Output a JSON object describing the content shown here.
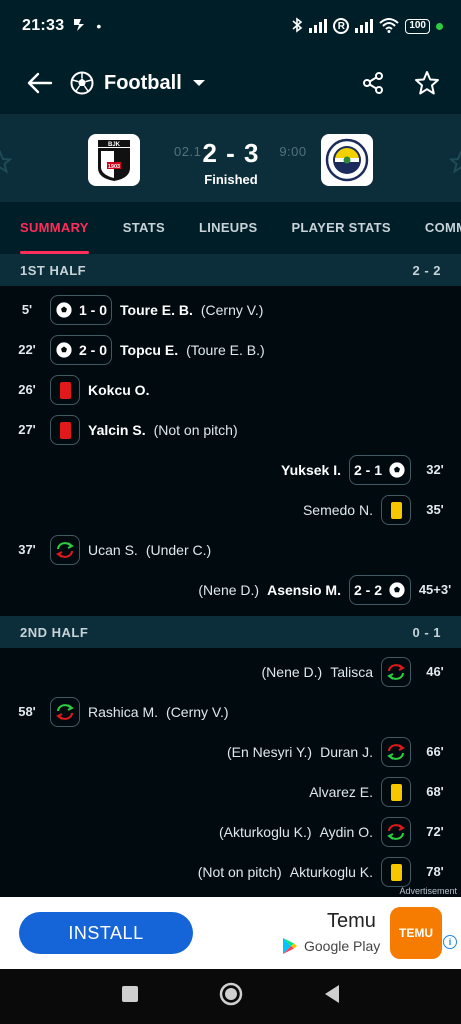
{
  "status_bar": {
    "time": "21:33",
    "battery": "100"
  },
  "header": {
    "sport": "Football",
    "sport_icon": "football-icon"
  },
  "match": {
    "ghost_text": "02.1",
    "ghost_time": "9:00",
    "score": "2 - 3",
    "status": "Finished",
    "home_team_icon": "besiktas-crest",
    "away_team_icon": "fenerbahce-crest"
  },
  "tabs": [
    "SUMMARY",
    "STATS",
    "LINEUPS",
    "PLAYER STATS",
    "COMM"
  ],
  "halves": [
    {
      "label": "1ST HALF",
      "score": "2 - 2",
      "events": [
        {
          "side": "home",
          "minute": "5'",
          "type": "goal",
          "score": "1 - 0",
          "player": "Toure E. B.",
          "assist": "(Cerny V.)"
        },
        {
          "side": "home",
          "minute": "22'",
          "type": "goal",
          "score": "2 - 0",
          "player": "Topcu E.",
          "assist": "(Toure E. B.)"
        },
        {
          "side": "home",
          "minute": "26'",
          "type": "red-card",
          "player": "Kokcu O.",
          "assist": ""
        },
        {
          "side": "home",
          "minute": "27'",
          "type": "red-card",
          "player": "Yalcin S.",
          "assist": "(Not on pitch)"
        },
        {
          "side": "away",
          "minute": "32'",
          "type": "goal",
          "score": "2 - 1",
          "player": "Yuksek I.",
          "assist": ""
        },
        {
          "side": "away",
          "minute": "35'",
          "type": "yellow-card",
          "player": "Semedo N.",
          "assist": ""
        },
        {
          "side": "home",
          "minute": "37'",
          "type": "substitution",
          "player": "Ucan S.",
          "assist": "(Under C.)"
        },
        {
          "side": "away",
          "minute": "45+3'",
          "type": "goal",
          "score": "2 - 2",
          "player": "Asensio M.",
          "assist": "(Nene D.)"
        }
      ]
    },
    {
      "label": "2ND HALF",
      "score": "0 - 1",
      "events": [
        {
          "side": "away",
          "minute": "46'",
          "type": "substitution",
          "player": "Talisca",
          "assist": "(Nene D.)"
        },
        {
          "side": "home",
          "minute": "58'",
          "type": "substitution",
          "player": "Rashica M.",
          "assist": "(Cerny V.)"
        },
        {
          "side": "away",
          "minute": "66'",
          "type": "substitution",
          "player": "Duran J.",
          "assist": "(En Nesyri Y.)"
        },
        {
          "side": "away",
          "minute": "68'",
          "type": "yellow-card",
          "player": "Alvarez E.",
          "assist": ""
        },
        {
          "side": "away",
          "minute": "72'",
          "type": "substitution",
          "player": "Aydin O.",
          "assist": "(Akturkoglu K.)"
        },
        {
          "side": "away",
          "minute": "78'",
          "type": "yellow-card",
          "player": "Akturkoglu K.",
          "assist": "(Not on pitch)"
        }
      ]
    }
  ],
  "ad": {
    "label": "Advertisement",
    "install": "INSTALL",
    "app_name": "Temu",
    "store": "Google Play",
    "logo_text": "TEMU"
  },
  "colors": {
    "accent": "#ff2d5a",
    "header_bg": "#001e28",
    "section_bg": "#0c2e3a",
    "body_bg": "#010a0f"
  }
}
